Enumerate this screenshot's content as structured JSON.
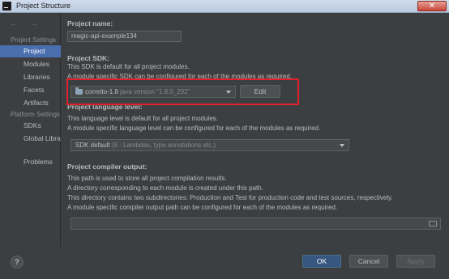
{
  "window": {
    "title": "Project Structure",
    "close_glyph": "✕"
  },
  "sidebar": {
    "nav_arrows": "← →",
    "project_settings_header": "Project Settings",
    "platform_settings_header": "Platform Settings",
    "items": [
      {
        "label": "Project",
        "selected": true
      },
      {
        "label": "Modules"
      },
      {
        "label": "Libraries"
      },
      {
        "label": "Facets"
      },
      {
        "label": "Artifacts"
      },
      {
        "label": "SDKs"
      },
      {
        "label": "Global Libraries"
      },
      {
        "label": "Problems"
      }
    ]
  },
  "project_name": {
    "label": "Project name:",
    "value": "magic-api-example134"
  },
  "project_sdk": {
    "label": "Project SDK:",
    "desc_line1": "This SDK is default for all project modules.",
    "desc_line2": "A module specific SDK can be configured for each of the modules as required.",
    "selected_name": "corretto-1.8",
    "selected_version": "java version \"1.8.0_292\"",
    "edit_label": "Edit"
  },
  "language_level": {
    "label": "Project language level:",
    "desc_line1": "This language level is default for all project modules.",
    "desc_line2": "A module specific language level can be configured for each of the modules as required.",
    "selected_name": "SDK default",
    "selected_detail": "(8 - Lambdas, type annotations etc.)"
  },
  "compiler_output": {
    "label": "Project compiler output:",
    "desc_line1": "This path is used to store all project compilation results.",
    "desc_line2": "A directory corresponding to each module is created under this path.",
    "desc_line3": "This directory contains two subdirectories: Production and Test for production code and test sources, respectively.",
    "desc_line4": "A module specific compiler output path can be configured for each of the modules as required.",
    "value": ""
  },
  "footer": {
    "help_label": "?",
    "ok_label": "OK",
    "cancel_label": "Cancel",
    "apply_label": "Apply"
  },
  "colors": {
    "accent": "#4b6eaf",
    "highlight": "#e0202a",
    "background": "#3c3f41"
  }
}
